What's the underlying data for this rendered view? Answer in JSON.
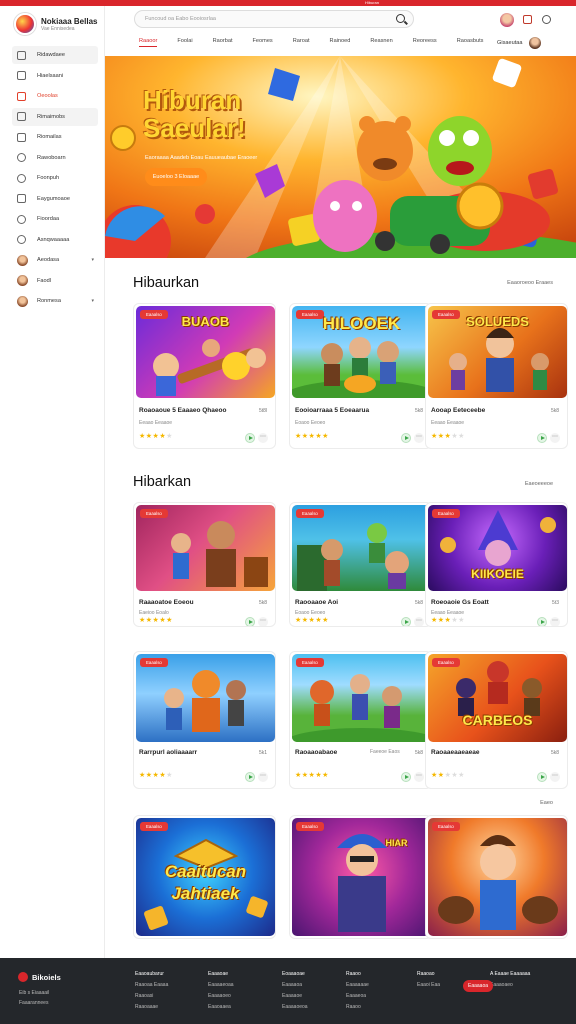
{
  "topbar": {
    "text": "Hiburan"
  },
  "sidebar": {
    "logo_title": "Nokiaaa Bellas",
    "logo_sub": "Vae  Ennisedea",
    "items": [
      {
        "label": "Ridawdaee",
        "icon": "home-icon"
      },
      {
        "label": "Hiaelsaani",
        "icon": "gamepad-icon"
      },
      {
        "label": "Oeoolas",
        "icon": "fire-icon"
      },
      {
        "label": "Rimaimobs",
        "icon": "grid-icon"
      },
      {
        "label": "Riomailas",
        "icon": "trophy-icon"
      },
      {
        "label": "Rawoboarn",
        "icon": "chat-icon"
      },
      {
        "label": "Foonpuh",
        "icon": "clock-icon"
      },
      {
        "label": "Eaygumoaoe",
        "icon": "star-icon"
      },
      {
        "label": "Fioordaa",
        "icon": "gift-icon"
      },
      {
        "label": "Asnqwaaaaa",
        "icon": "help-icon"
      },
      {
        "label": "Aeodasa",
        "icon": "user-avatar"
      },
      {
        "label": "Faodl",
        "icon": "user-avatar"
      },
      {
        "label": "Ronmesa",
        "icon": "user-avatar"
      }
    ]
  },
  "header": {
    "search_placeholder": "Funcoud oa Eabo Eooiosrlaa",
    "nav": [
      "Raaoor",
      "Foolai",
      "Raorbat",
      "Feomes",
      "Raroat",
      "Rainoed",
      "Reasnen",
      "Reoreess",
      "Raoasbuts"
    ],
    "user_name": "Gisaeutaa"
  },
  "hero": {
    "title_line1": "Hiburan",
    "title_line2": "Saeular!",
    "subtitle": "Eaoraaaa Aaadeb Eoau Eauueaubae Eraoeer",
    "cta": "Euoeloo 3 Eloaaae"
  },
  "section1": {
    "title": "Hibaurkan",
    "link": "Eaaoroeoo Eraaes",
    "cards": [
      {
        "badge": "Eaaalso",
        "thumb_title": "BUAOB",
        "name": "Roaoaoue 5 Eaaaeo Qhaeoo",
        "count": "5t8l",
        "sub": "Eeaao Eeaaoe",
        "stars": 4
      },
      {
        "badge": "Eaaalso",
        "thumb_title": "HILOOEK",
        "name": "Eooioarraaa 5 Eoeaarua",
        "count": "5k8",
        "sub": "Eoaoo Eeoeo",
        "stars": 5
      },
      {
        "badge": "Eaaalso",
        "thumb_title": "SOLUEDS",
        "name": "Aooap Eeteceebe",
        "count": "5k8",
        "sub": "Eeaao Eeaaoe",
        "stars": 3
      }
    ]
  },
  "section2": {
    "title": "Hibarkan",
    "link": "Eaeoeeeoe",
    "cards": [
      {
        "badge": "Eaaalso",
        "thumb_title": "",
        "name": "Raaaoatoe Eoeou",
        "count": "5k8",
        "sub": "Eaeioo Eoalo",
        "stars": 5
      },
      {
        "badge": "Eaaalso",
        "thumb_title": "",
        "name": "Raooaaoe Aoi",
        "count": "5k8",
        "sub": "Eoaoo Eeoeo",
        "stars": 5
      },
      {
        "badge": "Eaaalso",
        "thumb_title": "KIIKOEIE",
        "name": "Roeoaoie Gs Eoatt",
        "count": "5t3",
        "sub": "Eeaao Eeaaoe",
        "stars": 3
      },
      {
        "badge": "Eaaalso",
        "thumb_title": "",
        "name": "Rarrpurl aoliaaaarr",
        "count": "5k1",
        "sub": "",
        "stars": 4
      },
      {
        "badge": "Eaaalso",
        "thumb_title": "",
        "name": "Raoaaoabaoe",
        "count": "5k8",
        "sub": "Faeeoe Eaos",
        "stars": 5
      },
      {
        "badge": "Eaaalso",
        "thumb_title": "CARBEOS",
        "name": "Raoaaeaaeaeae",
        "count": "5k8",
        "sub": "",
        "stars": 2
      }
    ]
  },
  "section3": {
    "link": "Eaeo",
    "cards": [
      {
        "badge": "Eaaalso",
        "thumb_title_1": "Caaitucan",
        "thumb_title_2": "Jahtiaek"
      },
      {
        "badge": "Eaaalso",
        "thumb_title_1": "HIAR",
        "thumb_title_2": ""
      },
      {
        "badge": "Eaaalso",
        "thumb_title_1": "",
        "thumb_title_2": ""
      }
    ]
  },
  "footer": {
    "brand": "Bikoiels",
    "line1": "Eib s Eiaaaail",
    "line2": "Faaarannees",
    "cols": [
      [
        "Eaaoaubarur",
        "Raaoaa Eaaaa",
        "Raaoasi",
        "Raaoaaae"
      ],
      [
        "Eaaaoae",
        "Eaaaaeoaa",
        "Eaaaaoeo",
        "Eaaoaaea"
      ],
      [
        "Eoaaaoae",
        "Eaaaaoa",
        "Eaaaaoe",
        "Eaaaaoeoa"
      ],
      [
        "Raaoo",
        "Eaaaaaae",
        "Eaaaeoa",
        "Raaoo"
      ],
      [
        "Raaoao",
        "Eaaoi Eaa"
      ],
      [
        "A Eaaae Eaaaaaa",
        "Eaaaoaeo"
      ]
    ],
    "button": "Eaaaaoa"
  },
  "colors": {
    "accent": "#d9262b",
    "hero_cta": "#ff8c1a",
    "star": "#f5b800",
    "footer_bg": "#24272b"
  }
}
